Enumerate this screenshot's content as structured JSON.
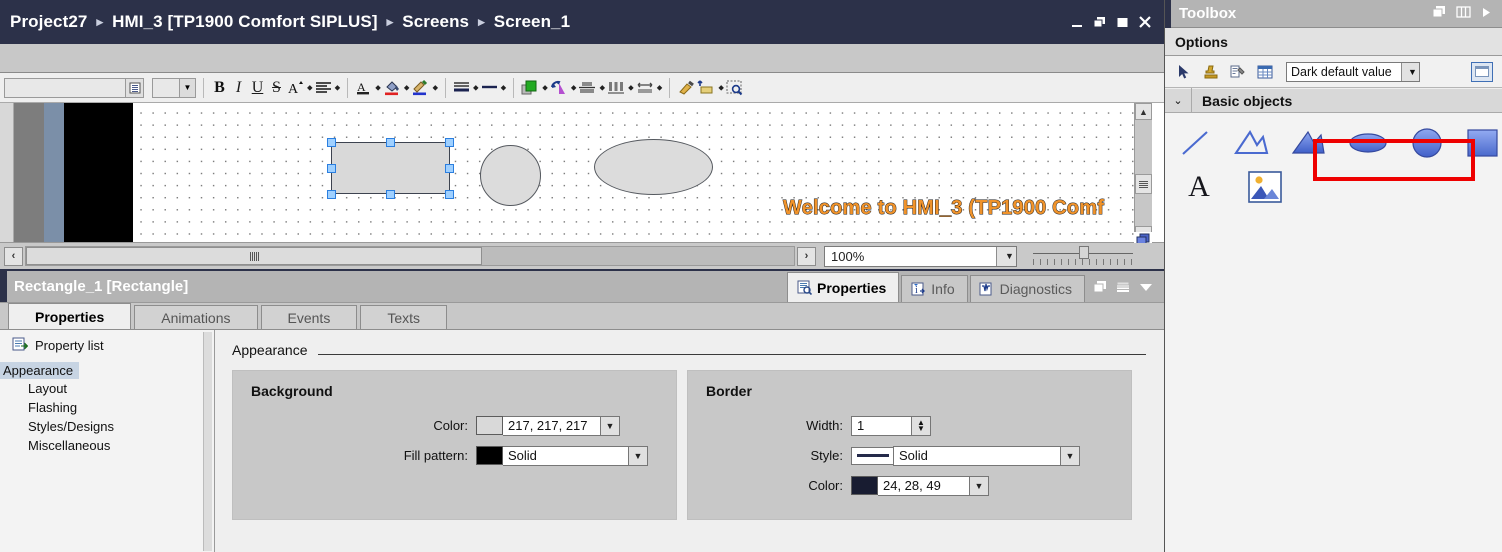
{
  "window": {
    "breadcrumb": [
      "Project27",
      "HMI_3 [TP1900 Comfort SIPLUS]",
      "Screens",
      "Screen_1"
    ],
    "separator": "▸",
    "controls": [
      {
        "name": "minimize-button",
        "label": "—"
      },
      {
        "name": "restore-button",
        "label": "❐"
      },
      {
        "name": "maximize-button",
        "label": "■"
      },
      {
        "name": "close-button",
        "label": "✕"
      }
    ]
  },
  "format_toolbar": {
    "font_value": "",
    "font_placeholder": "",
    "size_value": "",
    "buttons": [
      {
        "name": "bold-button",
        "label": "B"
      },
      {
        "name": "italic-button",
        "label": "I"
      },
      {
        "name": "underline-button",
        "label": "U"
      },
      {
        "name": "strikethrough-button",
        "label": "S"
      },
      {
        "name": "font-size-button",
        "label": "A"
      },
      {
        "name": "align-button",
        "label": "≡"
      },
      {
        "name": "font-color-button",
        "label": "A"
      },
      {
        "name": "fill-color-button",
        "label": "fill-bucket-icon"
      },
      {
        "name": "line-color-button",
        "label": "brush-icon"
      },
      {
        "name": "border-style-button",
        "label": "≡"
      },
      {
        "name": "line-width-button",
        "label": "—"
      },
      {
        "name": "order-button",
        "label": "order-icon"
      },
      {
        "name": "rotate-button",
        "label": "rotate-icon"
      },
      {
        "name": "align-vertical-button",
        "label": "align-v-icon"
      },
      {
        "name": "distribute-button",
        "label": "distribute-icon"
      },
      {
        "name": "size-equal-button",
        "label": "size-icon"
      },
      {
        "name": "format-painter-button",
        "label": "painter-icon"
      },
      {
        "name": "bring-front-button",
        "label": "front-icon"
      },
      {
        "name": "zoom-select-button",
        "label": "zoom-select-icon"
      }
    ]
  },
  "canvas": {
    "welcome_text": "Welcome to HMI_3 (TP1900 Comf",
    "shapes": [
      {
        "name": "rectangle-shape",
        "type": "rectangle",
        "selected": true,
        "fill": "#d9d9d9",
        "border": "#3d4350"
      },
      {
        "name": "circle-shape",
        "type": "circle",
        "selected": false,
        "fill": "#dcdcdc",
        "border": "#55595f"
      },
      {
        "name": "ellipse-shape",
        "type": "ellipse",
        "selected": false,
        "fill": "#dcdcdc",
        "border": "#55595f"
      }
    ],
    "zoom_value": "100%",
    "scroll_left_label": "‹",
    "scroll_right_label": "›",
    "scroll_up_label": "▲",
    "scroll_down_label": "▼"
  },
  "properties_panel": {
    "object_title": "Rectangle_1 [Rectangle]",
    "tabs": [
      {
        "name": "tab-properties",
        "label": "Properties",
        "active": true,
        "icon": "properties-icon"
      },
      {
        "name": "tab-info",
        "label": "Info",
        "active": false,
        "icon": "info-icon"
      },
      {
        "name": "tab-diagnostics",
        "label": "Diagnostics",
        "active": false,
        "icon": "diagnostics-icon"
      }
    ],
    "sub_tabs": [
      {
        "name": "subtab-properties",
        "label": "Properties",
        "active": true
      },
      {
        "name": "subtab-animations",
        "label": "Animations",
        "active": false
      },
      {
        "name": "subtab-events",
        "label": "Events",
        "active": false
      },
      {
        "name": "subtab-texts",
        "label": "Texts",
        "active": false
      }
    ],
    "property_list_header": "Property list",
    "property_list": [
      {
        "name": "property-appearance",
        "label": "Appearance",
        "selected": true
      },
      {
        "name": "property-layout",
        "label": "Layout",
        "selected": false
      },
      {
        "name": "property-flashing",
        "label": "Flashing",
        "selected": false
      },
      {
        "name": "property-styles-designs",
        "label": "Styles/Designs",
        "selected": false
      },
      {
        "name": "property-miscellaneous",
        "label": "Miscellaneous",
        "selected": false
      }
    ],
    "section_title": "Appearance",
    "background_group": {
      "title": "Background",
      "color_label": "Color:",
      "color_value": "217, 217, 217",
      "color_swatch": "#d9d9d9",
      "fill_pattern_label": "Fill pattern:",
      "fill_pattern_value": "Solid",
      "fill_pattern_swatch": "#000000"
    },
    "border_group": {
      "title": "Border",
      "width_label": "Width:",
      "width_value": "1",
      "style_label": "Style:",
      "style_value": "Solid",
      "style_line_color": "#252a4a",
      "color_label": "Color:",
      "color_value": "24, 28, 49",
      "color_swatch": "#181c31"
    }
  },
  "toolbox": {
    "title": "Toolbox",
    "options_label": "Options",
    "theme_value": "Dark default value",
    "tools": [
      {
        "name": "select-tool",
        "label": "cursor-icon"
      },
      {
        "name": "stamp-tool",
        "label": "stamp-icon"
      },
      {
        "name": "settings-tool",
        "label": "wrench-icon"
      },
      {
        "name": "table-tool",
        "label": "table-icon"
      }
    ],
    "group_label": "Basic objects",
    "basic_objects": [
      {
        "name": "object-line",
        "label": "line-icon",
        "highlighted": false
      },
      {
        "name": "object-polyline",
        "label": "polyline-icon",
        "highlighted": false
      },
      {
        "name": "object-polygon",
        "label": "polygon-icon",
        "highlighted": false
      },
      {
        "name": "object-ellipse",
        "label": "ellipse-icon",
        "highlighted": true
      },
      {
        "name": "object-circle",
        "label": "circle-icon",
        "highlighted": true
      },
      {
        "name": "object-rectangle",
        "label": "rectangle-icon",
        "highlighted": true
      },
      {
        "name": "object-text-field",
        "label": "A",
        "highlighted": false
      },
      {
        "name": "object-graphic-view",
        "label": "image-icon",
        "highlighted": false
      }
    ],
    "highlight_color": "#ee0000"
  }
}
